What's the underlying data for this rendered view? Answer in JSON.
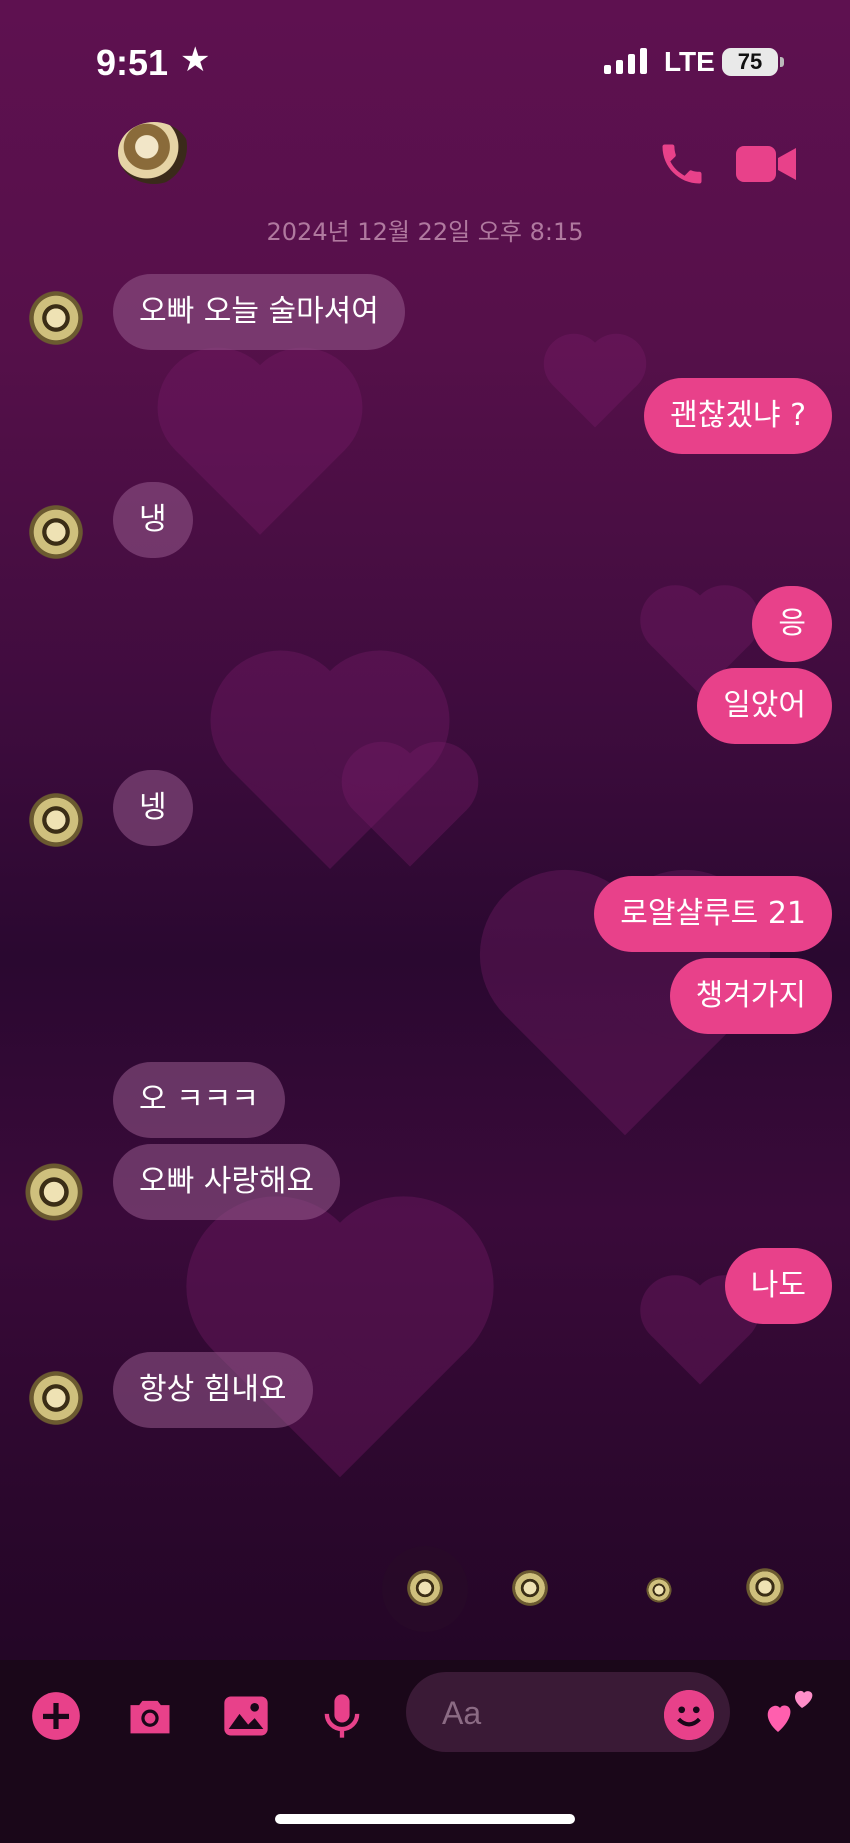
{
  "status_bar": {
    "time": "9:51",
    "star": "★",
    "network": "LTE",
    "battery": "75"
  },
  "header": {
    "call_icon": "phone-icon",
    "video_icon": "video-camera-icon"
  },
  "date_stamp": "2024년 12월 22일 오후 8:15",
  "messages": [
    {
      "side": "in",
      "text": "오빠 오늘 술마셔여"
    },
    {
      "side": "out",
      "text": "괜찮겠냐 ?"
    },
    {
      "side": "in",
      "text": "냉"
    },
    {
      "side": "out",
      "text": "응"
    },
    {
      "side": "out",
      "text": "일았어"
    },
    {
      "side": "in",
      "text": "넹"
    },
    {
      "side": "out",
      "text": "로얄샬루트 21"
    },
    {
      "side": "out",
      "text": "챙겨가지"
    },
    {
      "side": "in",
      "text": "오 ㅋㅋㅋ"
    },
    {
      "side": "in",
      "text": "오빠 사랑해요"
    },
    {
      "side": "out",
      "text": "나도"
    },
    {
      "side": "in",
      "text": "항상 힘내요"
    }
  ],
  "composer": {
    "placeholder": "Aa",
    "icons": [
      "plus-icon",
      "camera-icon",
      "image-icon",
      "microphone-icon",
      "emoji-icon",
      "hearts-icon"
    ]
  },
  "colors": {
    "accent": "#e8418a",
    "incoming_bubble": "#8a4d80",
    "background_top": "#5e1150",
    "background_bottom": "#1c0520"
  }
}
